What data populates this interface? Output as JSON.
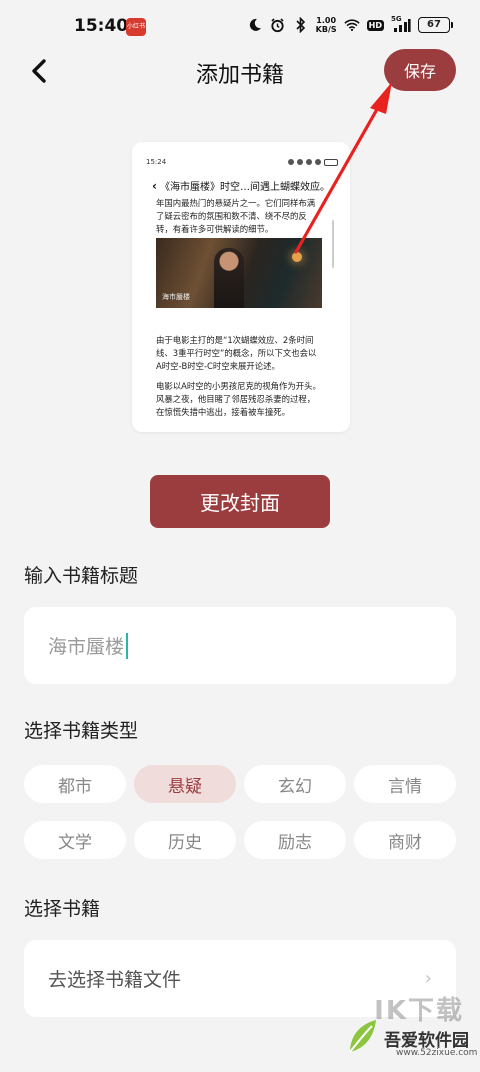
{
  "status_bar": {
    "time": "15:40",
    "app_badge": "小红书",
    "net_speed_value": "1.00",
    "net_speed_unit": "KB/S",
    "hd": "HD",
    "signal": "5G",
    "battery": "67",
    "icons": [
      "moon-icon",
      "alarm-icon",
      "bluetooth-icon",
      "wifi-icon",
      "signal-icon"
    ]
  },
  "header": {
    "title": "添加书籍",
    "save_label": "保存"
  },
  "cover_preview": {
    "time": "15:24",
    "title": "《海市蜃楼》时空…间遇上蝴蝶效应。",
    "paragraph1": "年国内最热门的悬疑片之一。它们同样布满了疑云密布的氛围和数不清、绕不尽的反转，有着许多可供解读的细节。",
    "image_caption": "海市蜃楼",
    "paragraph2": "由于电影主打的是“1次蝴蝶效应、2条时间线、3重平行时空”的概念，所以下文也会以A时空-B时空-C时空来展开论述。",
    "paragraph3": "电影以A时空的小男孩尼克的视角作为开头。风暴之夜，他目睹了邻居残忍杀妻的过程，在惊慌失措中逃出，接着被车撞死。"
  },
  "change_cover_label": "更改封面",
  "title_section": {
    "label": "输入书籍标题",
    "value": "海市蜃楼"
  },
  "type_section": {
    "label": "选择书籍类型",
    "tags": [
      "都市",
      "悬疑",
      "玄幻",
      "言情",
      "文学",
      "历史",
      "励志",
      "商财"
    ],
    "selected": "悬疑"
  },
  "book_section": {
    "label": "选择书籍",
    "picker_text": "去选择书籍文件"
  },
  "watermark": {
    "top": "ⅠK下载",
    "name": "吾爱软件园",
    "url": "www.52zixue.com"
  },
  "colors": {
    "accent": "#9b3c3f",
    "tag_selected_bg": "#f1dcdc",
    "background": "#f3f3f3",
    "caret": "#28b6a7",
    "annotation": "#e8221e"
  }
}
